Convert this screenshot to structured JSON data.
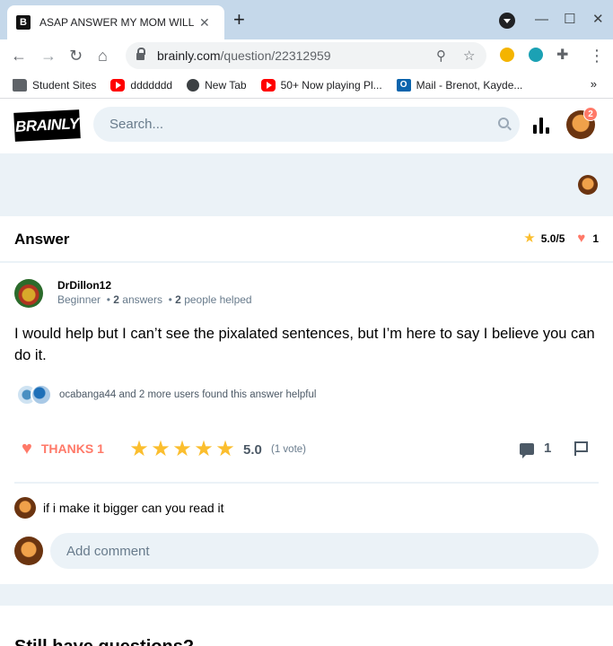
{
  "browser": {
    "tab_title": "ASAP ANSWER MY MOM WILL G",
    "tab_favicon": "B",
    "url_domain": "brainly.com",
    "url_path": "/question/22312959",
    "bookmarks": [
      {
        "label": "Student Sites",
        "icon": "folder-icon"
      },
      {
        "label": "ddddddd",
        "icon": "youtube-icon"
      },
      {
        "label": "New Tab",
        "icon": "globe-icon"
      },
      {
        "label": "50+ Now playing Pl...",
        "icon": "youtube-icon"
      },
      {
        "label": "Mail - Brenot, Kayde...",
        "icon": "outlook-icon"
      }
    ]
  },
  "header": {
    "logo_text": "BRAINLY",
    "search_placeholder": "Search...",
    "notification_count": "2"
  },
  "answer": {
    "heading": "Answer",
    "rating_summary": "5.0/5",
    "likes": "1",
    "author": {
      "name": "DrDillon12",
      "rank": "Beginner",
      "answers_count": "2",
      "answers_label": "answers",
      "helped_count": "2",
      "helped_label": "people helped"
    },
    "text": "I would help but I can’t see the pixalated sentences, but I’m here to say I believe you can do it.",
    "helpful_text": "ocabanga44 and 2 more users found this answer helpful",
    "thanks_label": "THANKS 1",
    "stars": 5,
    "rating": "5.0",
    "votes": "(1 vote)",
    "comment_count": "1"
  },
  "comments": [
    {
      "text": "if i make it bigger can you read it"
    }
  ],
  "add_comment_placeholder": "Add comment",
  "next_heading": "Still have questions?",
  "colors": {
    "accent_red": "#ff7968",
    "star_yellow": "#fbbe2e",
    "light_blue": "#ebf2f7",
    "chrome_tabbar": "#c5d8ea"
  }
}
